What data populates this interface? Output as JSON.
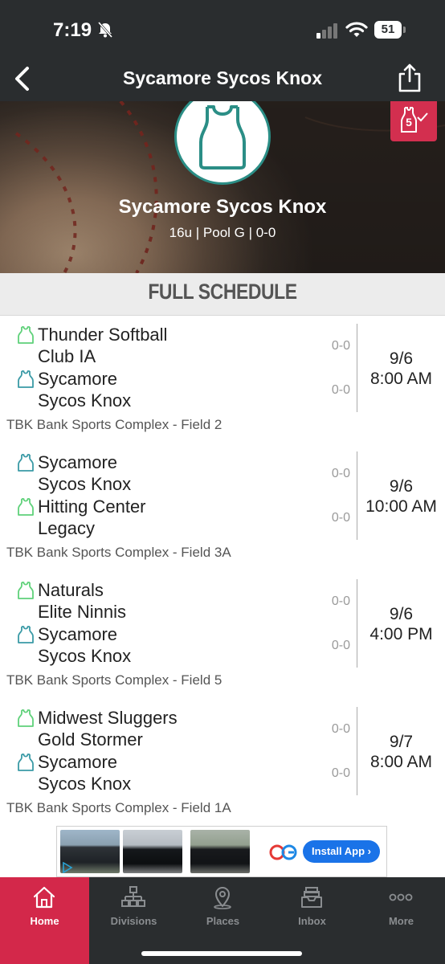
{
  "status_bar": {
    "time": "7:19",
    "battery": "51"
  },
  "nav": {
    "title": "Sycamore Sycos Knox"
  },
  "hero": {
    "team_name": "Sycamore Sycos Knox",
    "subtitle": "16u | Pool G | 0-0",
    "badge_number": "5"
  },
  "schedule": {
    "title": "FULL SCHEDULE",
    "games": [
      {
        "home": "Thunder Softball Club IA",
        "home_lines": [
          "Thunder Softball",
          "Club IA"
        ],
        "home_icon": "jersey-green",
        "home_score": "0-0",
        "away": "Sycamore Sycos Knox",
        "away_lines": [
          "Sycamore",
          "Sycos Knox"
        ],
        "away_icon": "jersey-teal",
        "away_score": "0-0",
        "date": "9/6",
        "time": "8:00 AM",
        "venue": "TBK Bank Sports Complex - Field 2"
      },
      {
        "home": "Sycamore Sycos Knox",
        "home_lines": [
          "Sycamore",
          "Sycos Knox"
        ],
        "home_icon": "jersey-teal",
        "home_score": "0-0",
        "away": "Hitting Center Legacy",
        "away_lines": [
          "Hitting Center",
          "Legacy"
        ],
        "away_icon": "jersey-green",
        "away_score": "0-0",
        "date": "9/6",
        "time": "10:00 AM",
        "venue": "TBK Bank Sports Complex - Field 3A"
      },
      {
        "home": "Naturals Elite Ninnis",
        "home_lines": [
          "Naturals",
          "Elite Ninnis"
        ],
        "home_icon": "jersey-green",
        "home_score": "0-0",
        "away": "Sycamore Sycos Knox",
        "away_lines": [
          "Sycamore",
          "Sycos Knox"
        ],
        "away_icon": "jersey-teal",
        "away_score": "0-0",
        "date": "9/6",
        "time": "4:00 PM",
        "venue": "TBK Bank Sports Complex - Field 5"
      },
      {
        "home": "Midwest Sluggers Gold Stormer",
        "home_lines": [
          "Midwest Sluggers",
          "Gold Stormer"
        ],
        "home_icon": "jersey-green",
        "home_score": "0-0",
        "away": "Sycamore Sycos Knox",
        "away_lines": [
          "Sycamore",
          "Sycos Knox"
        ],
        "away_icon": "jersey-teal",
        "away_score": "0-0",
        "date": "9/7",
        "time": "8:00 AM",
        "venue": "TBK Bank Sports Complex - Field 1A"
      }
    ]
  },
  "ad": {
    "button_label": "Install App ›"
  },
  "tabs": [
    {
      "label": "Home",
      "icon": "home-icon",
      "active": true
    },
    {
      "label": "Divisions",
      "icon": "divisions-icon",
      "active": false
    },
    {
      "label": "Places",
      "icon": "places-icon",
      "active": false
    },
    {
      "label": "Inbox",
      "icon": "inbox-icon",
      "active": false
    },
    {
      "label": "More",
      "icon": "more-icon",
      "active": false
    }
  ],
  "colors": {
    "accent": "#d3284a",
    "dark_bar": "#2a2d2f",
    "teal": "#2b8e86",
    "green_icon": "#5fd17a",
    "teal_icon": "#3a9aa6"
  }
}
